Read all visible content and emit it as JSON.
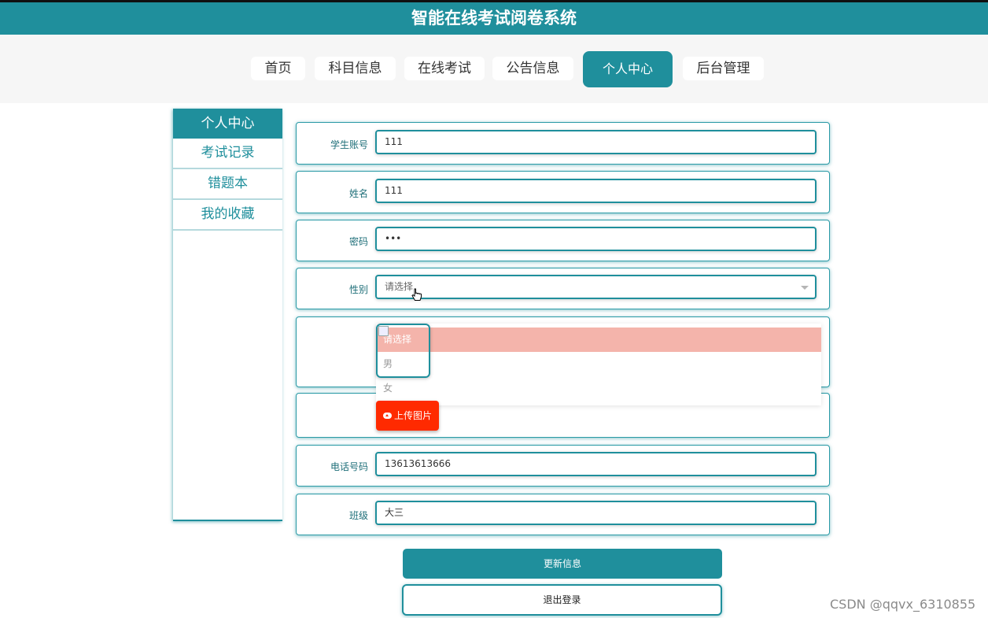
{
  "header": {
    "title": "智能在线考试阅卷系统"
  },
  "nav": {
    "items": [
      "首页",
      "科目信息",
      "在线考试",
      "公告信息",
      "个人中心",
      "后台管理"
    ],
    "active": "个人中心"
  },
  "sidebar": {
    "title": "个人中心",
    "items": [
      "考试记录",
      "错题本",
      "我的收藏"
    ]
  },
  "form": {
    "account": {
      "label": "学生账号",
      "value": "111"
    },
    "name": {
      "label": "姓名",
      "value": "111"
    },
    "password": {
      "label": "密码",
      "value": "•••"
    },
    "gender": {
      "label": "性别",
      "placeholder": "请选择",
      "options": [
        "请选择",
        "男",
        "女"
      ],
      "highlighted": "请选择"
    },
    "upload_label": "上传图片",
    "phone": {
      "label": "电话号码",
      "value": "13613613666"
    },
    "class": {
      "label": "班级",
      "value": "大三"
    }
  },
  "actions": {
    "update": "更新信息",
    "logout": "退出登录"
  },
  "watermark": "CSDN @qqvx_6310855",
  "colors": {
    "primary": "#1f8f9c",
    "upload": "#ff2a00",
    "highlight": "#f4b4ab"
  },
  "icons": [
    "cloud-upload-icon",
    "pointer-cursor-icon",
    "chevron-down-icon",
    "broken-image-icon"
  ]
}
